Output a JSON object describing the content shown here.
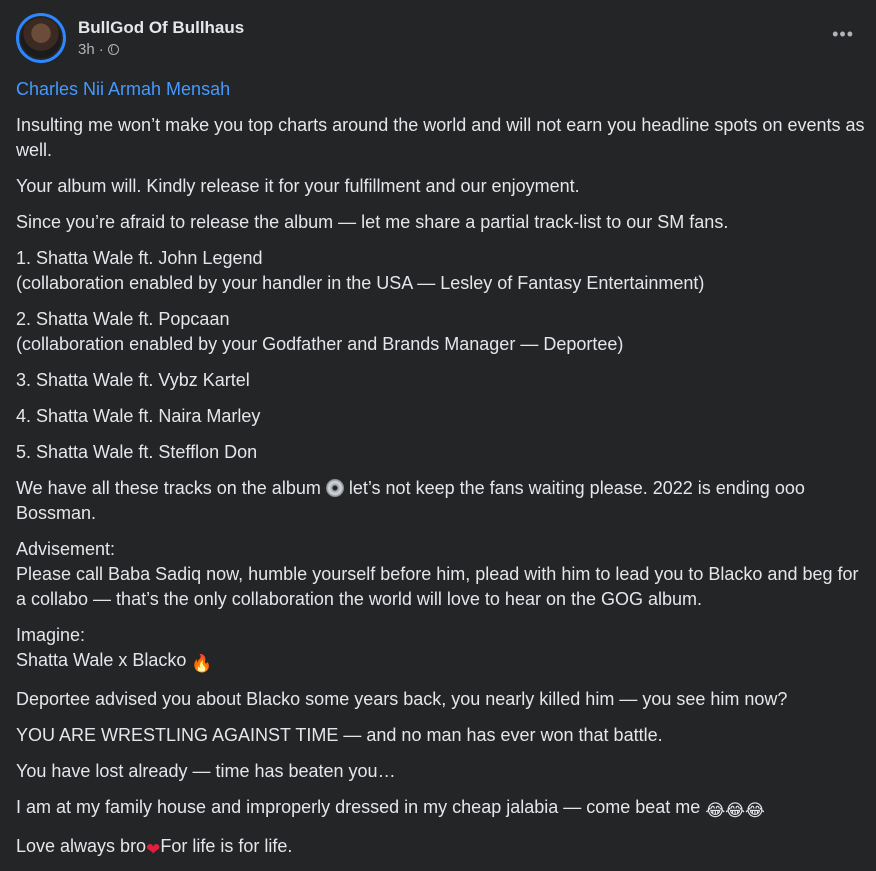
{
  "header": {
    "author": "BullGod Of Bullhaus",
    "time": "3h",
    "dot": "·",
    "more": "•••"
  },
  "post": {
    "mention": "Charles Nii Armah Mensah",
    "p1": "Insulting me won’t make you top charts around the world and will not earn you headline spots on events as well.",
    "p2": "Your album will. Kindly release it for your fulfillment and our enjoyment.",
    "p3": "Since you’re afraid to release the album — let me share a partial track-list to our SM fans.",
    "t1": "1.  Shatta Wale ft. John Legend",
    "t1note": "(collaboration enabled by your handler in the USA — Lesley of Fantasy Entertainment)",
    "t2": "2.  Shatta Wale ft. Popcaan",
    "t2note": "(collaboration enabled by your Godfather and Brands Manager — Deportee)",
    "t3": "3.  Shatta Wale ft. Vybz Kartel",
    "t4": "4.  Shatta Wale ft. Naira Marley",
    "t5": "5.  Shatta Wale ft. Stefflon Don",
    "p4a": "We have all these tracks on the album",
    "p4b": " let’s not keep the fans waiting please. 2022 is ending ooo Bossman.",
    "adv_title": "Advisement:",
    "adv_text": "Please call Baba Sadiq now, humble yourself before him, plead with him to lead you to Blacko and beg for a collabo — that’s the only collaboration the world will love to hear on the GOG album.",
    "imagine_title": "Imagine:",
    "imagine_text": "Shatta Wale x Blacko ",
    "p5": "Deportee advised you about Blacko some years back, you nearly killed him — you see him now?",
    "p6": "YOU ARE WRESTLING AGAINST TIME — and no man has ever won that battle.",
    "p7": "You have lost already — time has beaten you…",
    "p8": "I am at my family house and improperly dressed in my cheap jalabia — come beat me ",
    "laughs": "😂😂😂",
    "fire": "🔥",
    "heart": "❤",
    "p9a": "Love always bro",
    "p9b": "For life is for life."
  }
}
